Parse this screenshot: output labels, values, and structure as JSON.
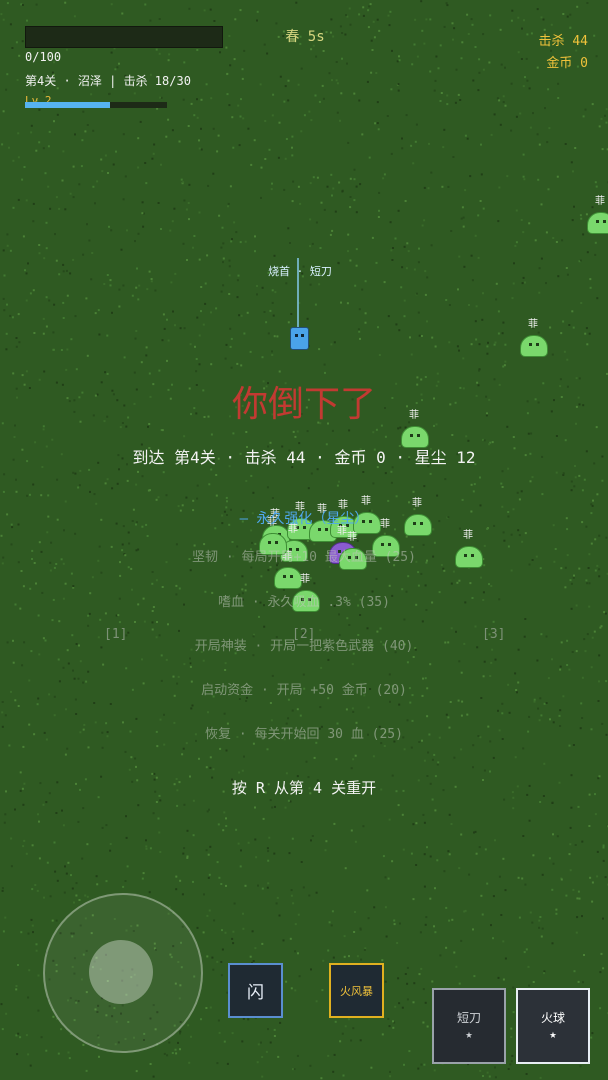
{
  "hud": {
    "hp_text": "0/100",
    "hp_fraction": 0,
    "stage_line": "第4关 · 沼泽 | 击杀 18/30",
    "level": "Lv 2",
    "xp_fraction": 0.6,
    "season": "春 5s",
    "kills": "击杀 44",
    "gold": "金币 0"
  },
  "player": {
    "weapon_label": "烧首 · 短刀"
  },
  "enemies": {
    "label": "菲"
  },
  "game_over": {
    "title": "你倒下了",
    "summary": "到达 第4关 · 击杀 44 · 金币 0 · 星尘 12",
    "upgrades_title": "— 永久强化（星尘）",
    "upgrades": [
      "坚韧 · 每局开局+10 最大血量 (25)",
      "嗜血 · 永久吸血 .3% (35)",
      "开局神装 · 开局一把紫色武器 (40)",
      "启动资金 · 开局 +50 金币 (20)",
      "恢复 · 每关开始回 30 血 (25)"
    ],
    "slots": [
      "[1]",
      "[2]",
      "[3]"
    ],
    "restart": "按 R 从第 4 关重开"
  },
  "controls": {
    "dash_label": "闪",
    "skill_label": "火风暴",
    "weapon1_name": "短刀",
    "weapon1_stars": "★",
    "weapon2_name": "火球",
    "weapon2_stars": "★"
  },
  "colors": {
    "grass": "#2f5a22",
    "title_red": "#c23a32",
    "gold": "#f0c23b",
    "accent_blue": "#4fa8ee"
  }
}
